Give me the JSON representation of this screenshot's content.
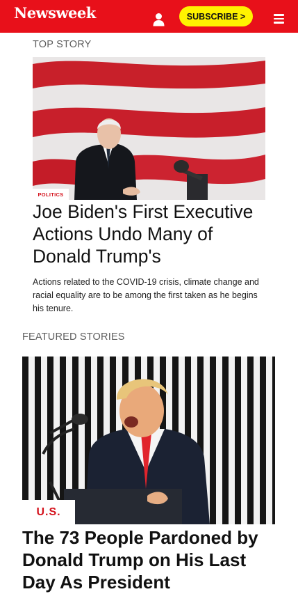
{
  "header": {
    "logo": "Newsweek",
    "subscribe_label": "SUBSCRIBE >",
    "brand_color": "#e8101a",
    "subscribe_color": "#fff200",
    "user_icon": "user-icon",
    "menu_icon": "hamburger-menu-icon"
  },
  "top_story": {
    "section_label": "TOP STORY",
    "tag": "POLITICS",
    "headline": "Joe Biden's First Executive Actions Undo Many of Donald Trump's",
    "summary": "Actions related to the COVID-19 crisis, climate change and racial equality are to be among the first taken as he begins his tenure."
  },
  "featured": {
    "section_label": "FEATURED STORIES",
    "tag": "U.S.",
    "headline": "The 73 People Pardoned by Donald Trump on His Last Day As President"
  }
}
